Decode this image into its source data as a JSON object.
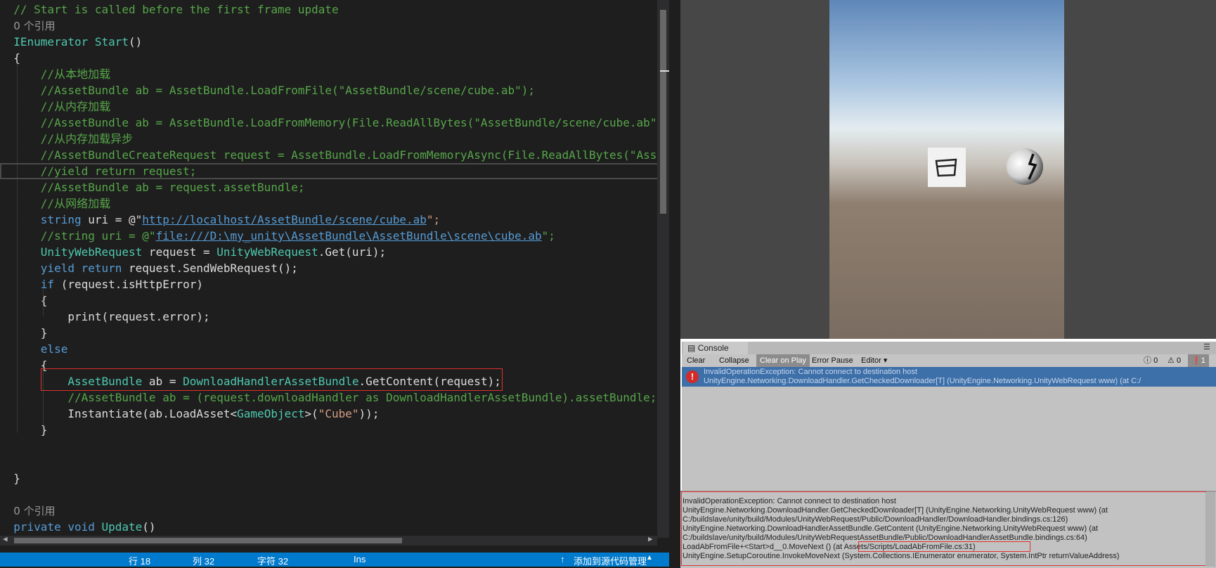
{
  "editor": {
    "lines": [
      {
        "parts": [
          {
            "t": "// Start is called before the first frame update",
            "c": "c"
          }
        ]
      },
      {
        "parts": [
          {
            "t": "0 个引用",
            "c": "ref"
          }
        ]
      },
      {
        "parts": [
          {
            "t": "IEnumerator ",
            "c": "t"
          },
          {
            "t": "Start",
            "c": "t"
          },
          {
            "t": "()",
            "c": ""
          }
        ]
      },
      {
        "parts": [
          {
            "t": "{",
            "c": ""
          }
        ]
      },
      {
        "parts": [
          {
            "t": "    //从本地加载",
            "c": "c"
          }
        ]
      },
      {
        "parts": [
          {
            "t": "    //AssetBundle ab = AssetBundle.LoadFromFile(\"AssetBundle/scene/cube.ab\");",
            "c": "c"
          }
        ]
      },
      {
        "parts": [
          {
            "t": "    //从内存加载",
            "c": "c"
          }
        ]
      },
      {
        "parts": [
          {
            "t": "    //AssetBundle ab = AssetBundle.LoadFromMemory(File.ReadAllBytes(\"AssetBundle/scene/cube.ab\"));",
            "c": "c"
          }
        ]
      },
      {
        "parts": [
          {
            "t": "    //从内存加载异步",
            "c": "c"
          }
        ]
      },
      {
        "parts": [
          {
            "t": "    //AssetBundleCreateRequest request = AssetBundle.LoadFromMemoryAsync(File.ReadAllBytes(\"AssetB",
            "c": "c"
          }
        ]
      },
      {
        "parts": [
          {
            "t": "    //yield return request;",
            "c": "c"
          }
        ],
        "hl": true
      },
      {
        "parts": [
          {
            "t": "    //AssetBundle ab = request.assetBundle;",
            "c": "c"
          }
        ]
      },
      {
        "parts": [
          {
            "t": "    //从网络加载",
            "c": "c"
          }
        ]
      },
      {
        "parts": [
          {
            "t": "    ",
            "c": ""
          },
          {
            "t": "string",
            "c": "k"
          },
          {
            "t": " uri = @\"",
            "c": ""
          },
          {
            "t": "http://localhost/AssetBundle/scene/cube.ab",
            "c": "lnk"
          },
          {
            "t": "\";",
            "c": "s"
          }
        ]
      },
      {
        "parts": [
          {
            "t": "    //string uri = @\"",
            "c": "c"
          },
          {
            "t": "file:///D:\\my_unity\\AssetBundle\\AssetBundle\\scene\\cube.ab",
            "c": "lnk"
          },
          {
            "t": "\";",
            "c": "c"
          }
        ]
      },
      {
        "parts": [
          {
            "t": "    ",
            "c": ""
          },
          {
            "t": "UnityWebRequest",
            "c": "t"
          },
          {
            "t": " request = ",
            "c": ""
          },
          {
            "t": "UnityWebRequest",
            "c": "t"
          },
          {
            "t": ".Get(uri);",
            "c": ""
          }
        ]
      },
      {
        "parts": [
          {
            "t": "    ",
            "c": ""
          },
          {
            "t": "yield return",
            "c": "k"
          },
          {
            "t": " request.SendWebRequest();",
            "c": ""
          }
        ]
      },
      {
        "parts": [
          {
            "t": "    ",
            "c": ""
          },
          {
            "t": "if",
            "c": "k"
          },
          {
            "t": " (request.isHttpError)",
            "c": ""
          }
        ]
      },
      {
        "parts": [
          {
            "t": "    {",
            "c": ""
          }
        ]
      },
      {
        "parts": [
          {
            "t": "        print(request.error);",
            "c": ""
          }
        ]
      },
      {
        "parts": [
          {
            "t": "    }",
            "c": ""
          }
        ]
      },
      {
        "parts": [
          {
            "t": "    ",
            "c": ""
          },
          {
            "t": "else",
            "c": "k"
          }
        ]
      },
      {
        "parts": [
          {
            "t": "    {",
            "c": ""
          }
        ]
      },
      {
        "parts": [
          {
            "t": "        ",
            "c": ""
          },
          {
            "t": "AssetBundle",
            "c": "t"
          },
          {
            "t": " ab = ",
            "c": ""
          },
          {
            "t": "DownloadHandlerAssetBundle",
            "c": "t"
          },
          {
            "t": ".GetContent(request);",
            "c": ""
          }
        ]
      },
      {
        "parts": [
          {
            "t": "        //AssetBundle ab = (request.downloadHandler as DownloadHandlerAssetBundle).assetBundle;",
            "c": "c"
          }
        ]
      },
      {
        "parts": [
          {
            "t": "        Instantiate(ab.LoadAsset<",
            "c": ""
          },
          {
            "t": "GameObject",
            "c": "t"
          },
          {
            "t": ">(",
            "c": ""
          },
          {
            "t": "\"Cube\"",
            "c": "s"
          },
          {
            "t": "));",
            "c": ""
          }
        ]
      },
      {
        "parts": [
          {
            "t": "    }",
            "c": ""
          }
        ]
      },
      {
        "parts": [
          {
            "t": "",
            "c": ""
          }
        ]
      },
      {
        "parts": [
          {
            "t": "",
            "c": ""
          }
        ]
      },
      {
        "parts": [
          {
            "t": "}",
            "c": ""
          }
        ]
      },
      {
        "parts": [
          {
            "t": "",
            "c": ""
          }
        ]
      },
      {
        "parts": [
          {
            "t": "0 个引用",
            "c": "ref"
          }
        ]
      },
      {
        "parts": [
          {
            "t": "private void ",
            "c": "k"
          },
          {
            "t": "Update",
            "c": "t"
          },
          {
            "t": "()",
            "c": ""
          }
        ]
      }
    ]
  },
  "statusbar": {
    "line": "行 18",
    "col": "列 32",
    "char": "字符 32",
    "ins": "Ins",
    "source_control": "添加到源代码管理"
  },
  "console": {
    "tab_label": "Console",
    "clear": "Clear",
    "collapse": "Collapse",
    "clear_on_play": "Clear on Play",
    "error_pause": "Error Pause",
    "editor": "Editor",
    "log_count": "0",
    "warn_count": "0",
    "error_count": "1",
    "entry_line1": "InvalidOperationException: Cannot connect to destination host",
    "entry_line2": "UnityEngine.Networking.DownloadHandler.GetCheckedDownloader[T] (UnityEngine.Networking.UnityWebRequest www) (at C:/",
    "detail": [
      "InvalidOperationException: Cannot connect to destination host",
      "UnityEngine.Networking.DownloadHandler.GetCheckedDownloader[T] (UnityEngine.Networking.UnityWebRequest www) (at",
      "C:/buildslave/unity/build/Modules/UnityWebRequest/Public/DownloadHandler/DownloadHandler.bindings.cs:126)",
      "UnityEngine.Networking.DownloadHandlerAssetBundle.GetContent (UnityEngine.Networking.UnityWebRequest www) (at",
      "C:/buildslave/unity/build/Modules/UnityWebRequestAssetBundle/Public/DownloadHandlerAssetBundle.bindings.cs:64)",
      "LoadAbFromFile+<Start>d__0.MoveNext () (at Assets/Scripts/LoadAbFromFile.cs:31)",
      "UnityEngine.SetupCoroutine.InvokeMoveNext (System.Collections.IEnumerator enumerator, System.IntPtr returnValueAddress)"
    ]
  },
  "colors": {
    "editor_bg": "#1e1e1e",
    "comment": "#57a64a",
    "keyword": "#569cd6",
    "type": "#4ec9b0",
    "string": "#d69d85",
    "status_bar": "#007acc",
    "error_row": "#3d6fa8",
    "highlight_box": "#e03030"
  },
  "icons": [
    "error-icon",
    "info-icon",
    "warning-icon",
    "menu-icon"
  ]
}
